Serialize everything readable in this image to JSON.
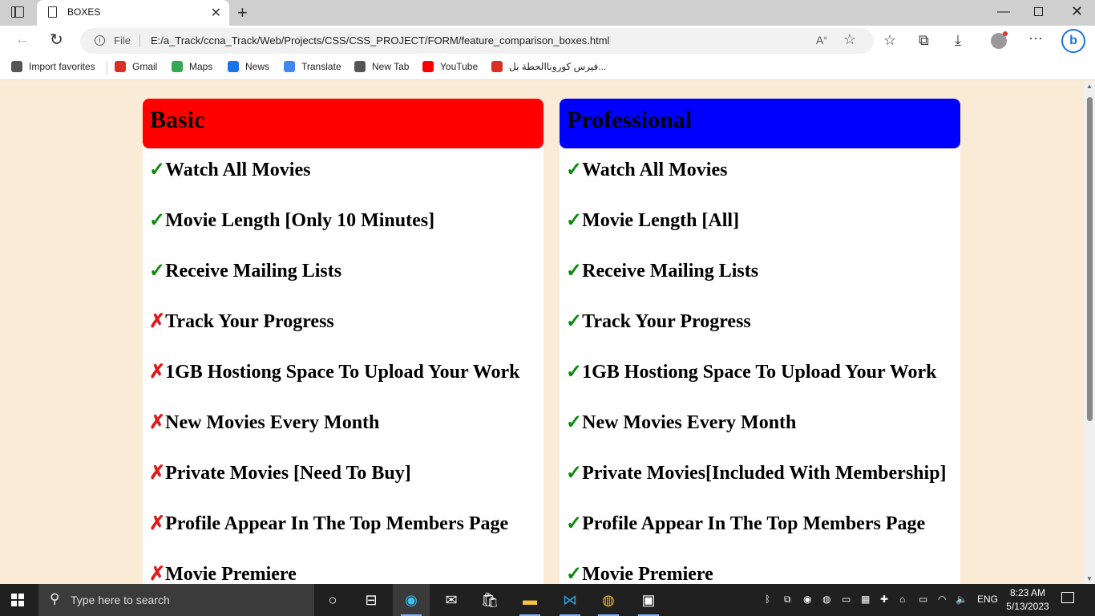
{
  "browser": {
    "tab_title": "BOXES",
    "address": {
      "scheme_label": "File",
      "url": "E:/a_Track/ccna_Track/Web/Projects/CSS/CSS_PROJECT/FORM/feature_comparison_boxes.html"
    },
    "favorites": [
      {
        "label": "Import favorites",
        "icon": "import-icon",
        "color": "#555555"
      },
      {
        "label": "Gmail",
        "icon": "gmail-icon",
        "color": "#d93025"
      },
      {
        "label": "Maps",
        "icon": "maps-icon",
        "color": "#34a853"
      },
      {
        "label": "News",
        "icon": "news-icon",
        "color": "#1a73e8"
      },
      {
        "label": "Translate",
        "icon": "translate-icon",
        "color": "#4285f4"
      },
      {
        "label": "New Tab",
        "icon": "page-icon",
        "color": "#555555"
      },
      {
        "label": "YouTube",
        "icon": "youtube-icon",
        "color": "#ff0000"
      },
      {
        "label": "فيرس كوروناالحطة بل...",
        "icon": "target-icon",
        "color": "#d93025"
      }
    ]
  },
  "page": {
    "background": "#faebd7",
    "plans": [
      {
        "name": "Basic",
        "header_color": "#ff0000",
        "features": [
          {
            "mark": "✓",
            "included": true,
            "text": "Watch All Movies"
          },
          {
            "mark": "✓",
            "included": true,
            "text": "Movie Length [Only 10 Minutes]"
          },
          {
            "mark": "✓",
            "included": true,
            "text": "Receive Mailing Lists"
          },
          {
            "mark": "✗",
            "included": false,
            "text": "Track Your Progress"
          },
          {
            "mark": "✗",
            "included": false,
            "text": "1GB Hostiong Space To Upload Your Work"
          },
          {
            "mark": "✗",
            "included": false,
            "text": "New Movies Every Month"
          },
          {
            "mark": "✗",
            "included": false,
            "text": "Private Movies [Need To Buy]"
          },
          {
            "mark": "✗",
            "included": false,
            "text": "Profile Appear In The Top Members Page"
          },
          {
            "mark": "✗",
            "included": false,
            "text": "Movie Premiere"
          }
        ]
      },
      {
        "name": "Professional",
        "header_color": "#0000ff",
        "features": [
          {
            "mark": "✓",
            "included": true,
            "text": "Watch All Movies"
          },
          {
            "mark": "✓",
            "included": true,
            "text": "Movie Length [All]"
          },
          {
            "mark": "✓",
            "included": true,
            "text": "Receive Mailing Lists"
          },
          {
            "mark": "✓",
            "included": true,
            "text": "Track Your Progress"
          },
          {
            "mark": "✓",
            "included": true,
            "text": "1GB Hostiong Space To Upload Your Work"
          },
          {
            "mark": "✓",
            "included": true,
            "text": "New Movies Every Month"
          },
          {
            "mark": "✓",
            "included": true,
            "text": "Private Movies[Included With Membership]"
          },
          {
            "mark": "✓",
            "included": true,
            "text": "Profile Appear In The Top Members Page"
          },
          {
            "mark": "✓",
            "included": true,
            "text": "Movie Premiere"
          }
        ]
      }
    ]
  },
  "taskbar": {
    "search_placeholder": "Type here to search",
    "language": "ENG",
    "time": "8:23 AM",
    "date": "5/13/2023"
  }
}
